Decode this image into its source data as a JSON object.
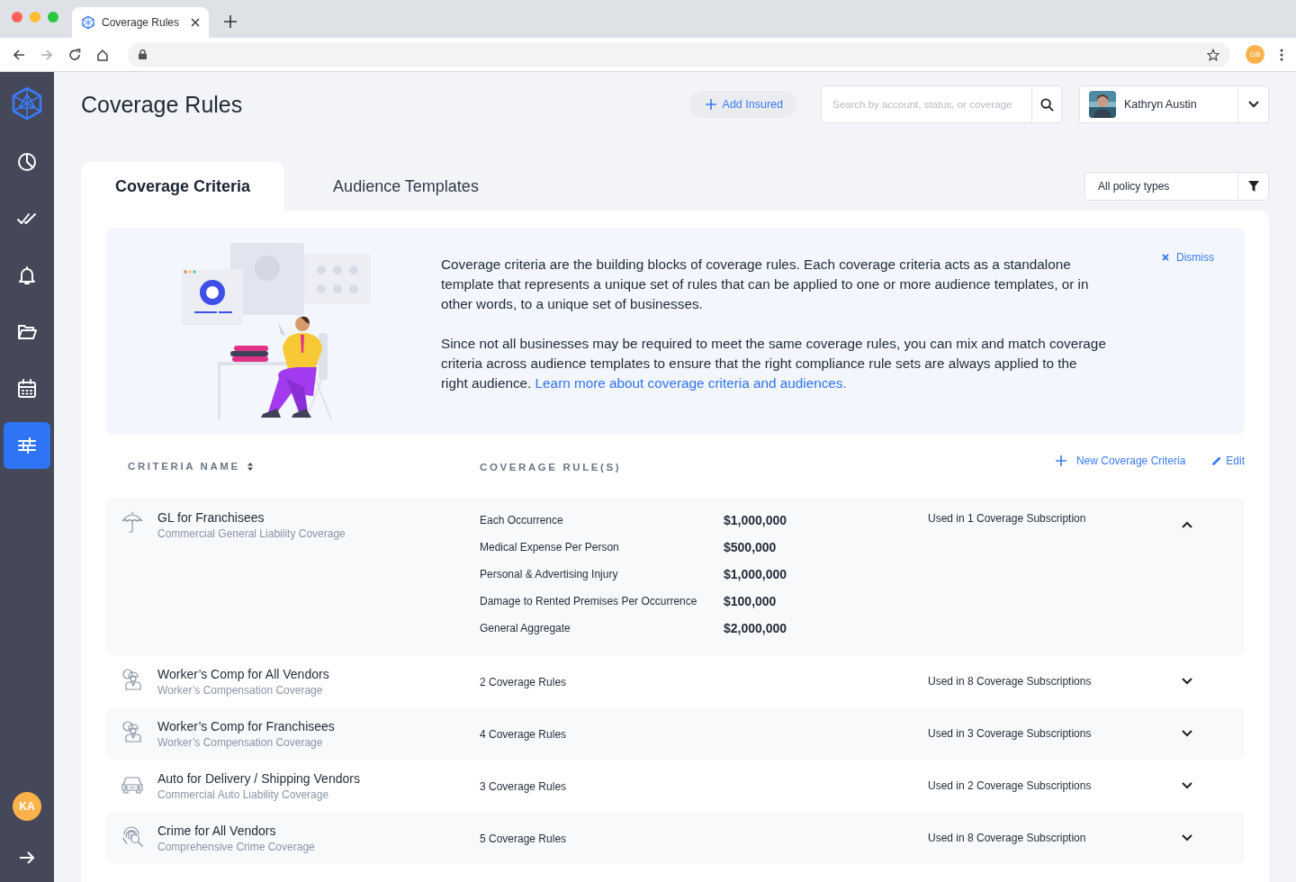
{
  "browser": {
    "tab_title": "Coverage Rules",
    "profile_initials": "GB"
  },
  "sidebar": {
    "items": [
      {
        "selected": false
      },
      {
        "selected": false
      },
      {
        "selected": false
      },
      {
        "selected": false
      },
      {
        "selected": false
      },
      {
        "selected": true
      }
    ],
    "user_initials": "KA"
  },
  "header": {
    "title": "Coverage Rules",
    "add_button": "Add Insured",
    "search": {
      "placeholder": "Search by account, status, or coverage"
    },
    "user": {
      "name": "Kathryn Austin"
    }
  },
  "tabs": [
    {
      "label": "Coverage Criteria",
      "selected": true
    },
    {
      "label": "Audience Templates",
      "selected": false
    }
  ],
  "filter": {
    "value": "All policy types"
  },
  "banner": {
    "paragraphs": [
      {
        "text": "Coverage criteria are the building blocks of coverage rules. Each coverage criteria acts as a standalone template that represents a unique set of rules that can be applied to one or more audience templates, or in other words, to a unique set of businesses."
      },
      {
        "text": "Since not all businesses may be required to meet the same coverage rules, you can mix and match coverage criteria across audience templates to ensure that the right compliance rule sets are always applied to the right audience.",
        "link": "Learn more about coverage criteria and audiences."
      }
    ],
    "dismiss": "Dismiss"
  },
  "table": {
    "columns": [
      "CRITERIA NAME",
      "COVERAGE RULE(S)"
    ],
    "actions": {
      "new": "New Coverage Criteria",
      "edit": "Edit"
    },
    "rows": [
      {
        "name": "GL for Franchisees",
        "subtitle": "Commercial General Liability Coverage",
        "expanded": true,
        "rules": [
          {
            "name": "Each Occurrence",
            "amount": "$1,000,000"
          },
          {
            "name": "Medical Expense Per Person",
            "amount": "$500,000"
          },
          {
            "name": "Personal & Advertising Injury",
            "amount": "$1,000,000"
          },
          {
            "name": "Damage to Rented Premises Per Occurrence",
            "amount": "$100,000"
          },
          {
            "name": "General Aggregate",
            "amount": "$2,000,000"
          }
        ],
        "usage": "Used in 1 Coverage Subscription"
      },
      {
        "name": "Worker’s Comp for All Vendors",
        "subtitle": "Worker’s Compensation Coverage",
        "expanded": false,
        "rule_count": "2 Coverage Rules",
        "usage": "Used in 8 Coverage Subscriptions"
      },
      {
        "name": "Worker’s Comp for Franchisees",
        "subtitle": "Worker’s Compensation Coverage",
        "expanded": false,
        "rule_count": "4 Coverage Rules",
        "usage": "Used in 3 Coverage Subscriptions"
      },
      {
        "name": "Auto for Delivery / Shipping Vendors",
        "subtitle": "Commercial Auto Liability Coverage",
        "expanded": false,
        "rule_count": "3 Coverage Rules",
        "usage": "Used in 2 Coverage Subscriptions"
      },
      {
        "name": "Crime for All Vendors",
        "subtitle": "Comprehensive Crime Coverage",
        "expanded": false,
        "rule_count": "5 Coverage Rules",
        "usage": "Used in 8 Coverage Subscription"
      }
    ]
  }
}
